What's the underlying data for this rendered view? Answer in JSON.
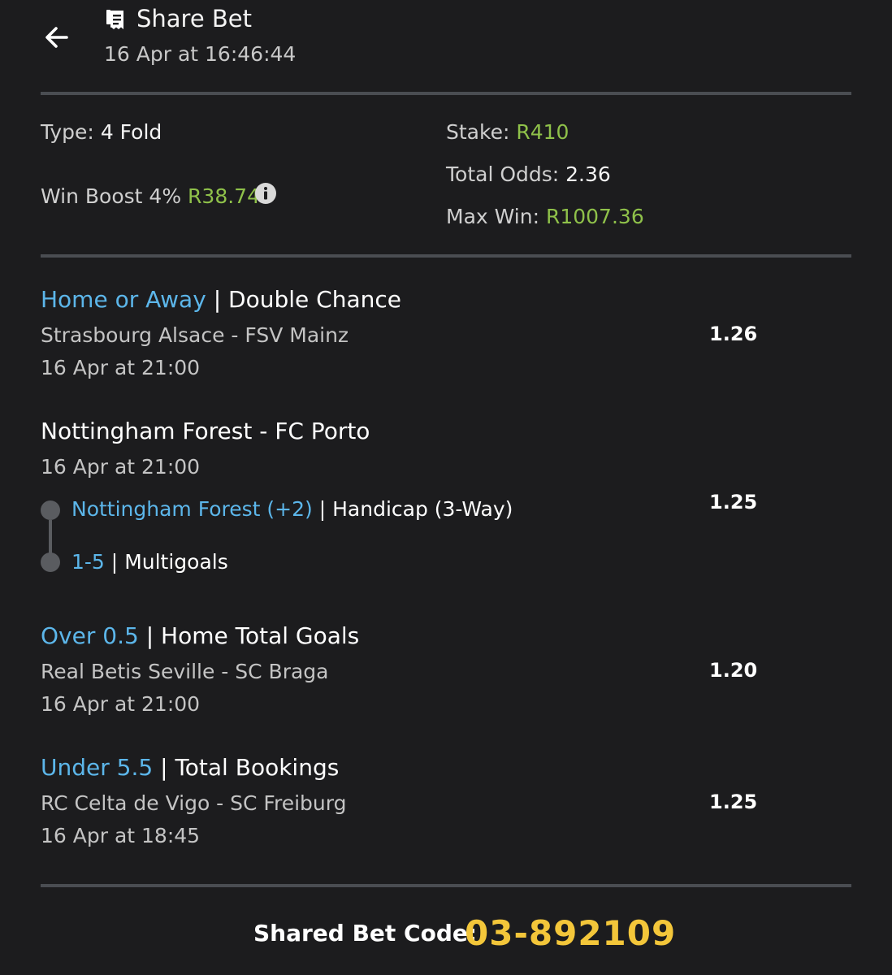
{
  "header": {
    "back_icon": "arrow-left-icon",
    "title_icon": "receipt-icon",
    "title": "Share Bet",
    "subtitle": "16 Apr at 16:46:44"
  },
  "summary": {
    "type_label": "Type:",
    "type_value": "4 Fold",
    "win_boost_label": "Win Boost 4%",
    "win_boost_value": "R38.74",
    "info_icon": "info-icon",
    "stake_label": "Stake:",
    "stake_value": "R410",
    "total_odds_label": "Total Odds:",
    "total_odds_value": "2.36",
    "max_win_label": "Max Win:",
    "max_win_value": "R1007.36"
  },
  "selections": [
    {
      "pick": "Home or Away",
      "separator": "|",
      "market": "Double Chance",
      "match": "Strasbourg Alsace - FSV Mainz",
      "time": "16 Apr at 21:00",
      "odds": "1.26"
    },
    {
      "match": "Nottingham Forest - FC Porto",
      "time": "16 Apr at 21:00",
      "odds": "1.25",
      "legs": [
        {
          "pick": "Nottingham Forest (+2)",
          "separator": "|",
          "market": "Handicap (3-Way)"
        },
        {
          "pick": "1-5",
          "separator": "|",
          "market": "Multigoals"
        }
      ]
    },
    {
      "pick": "Over 0.5",
      "separator": "|",
      "market": "Home Total Goals",
      "match": "Real Betis Seville - SC Braga",
      "time": "16 Apr at 21:00",
      "odds": "1.20"
    },
    {
      "pick": "Under 5.5",
      "separator": "|",
      "market": "Total Bookings",
      "match": "RC Celta de Vigo - SC Freiburg",
      "time": "16 Apr at 18:45",
      "odds": "1.25"
    }
  ],
  "footer": {
    "code_label": "Shared Bet Code:",
    "code_value": "03-892109"
  },
  "colors": {
    "background": "#1c1c1e",
    "accent_green": "#8fc14a",
    "accent_blue": "#5cb6ea",
    "code_yellow": "#f3c63a",
    "divider": "#4a4d52"
  }
}
